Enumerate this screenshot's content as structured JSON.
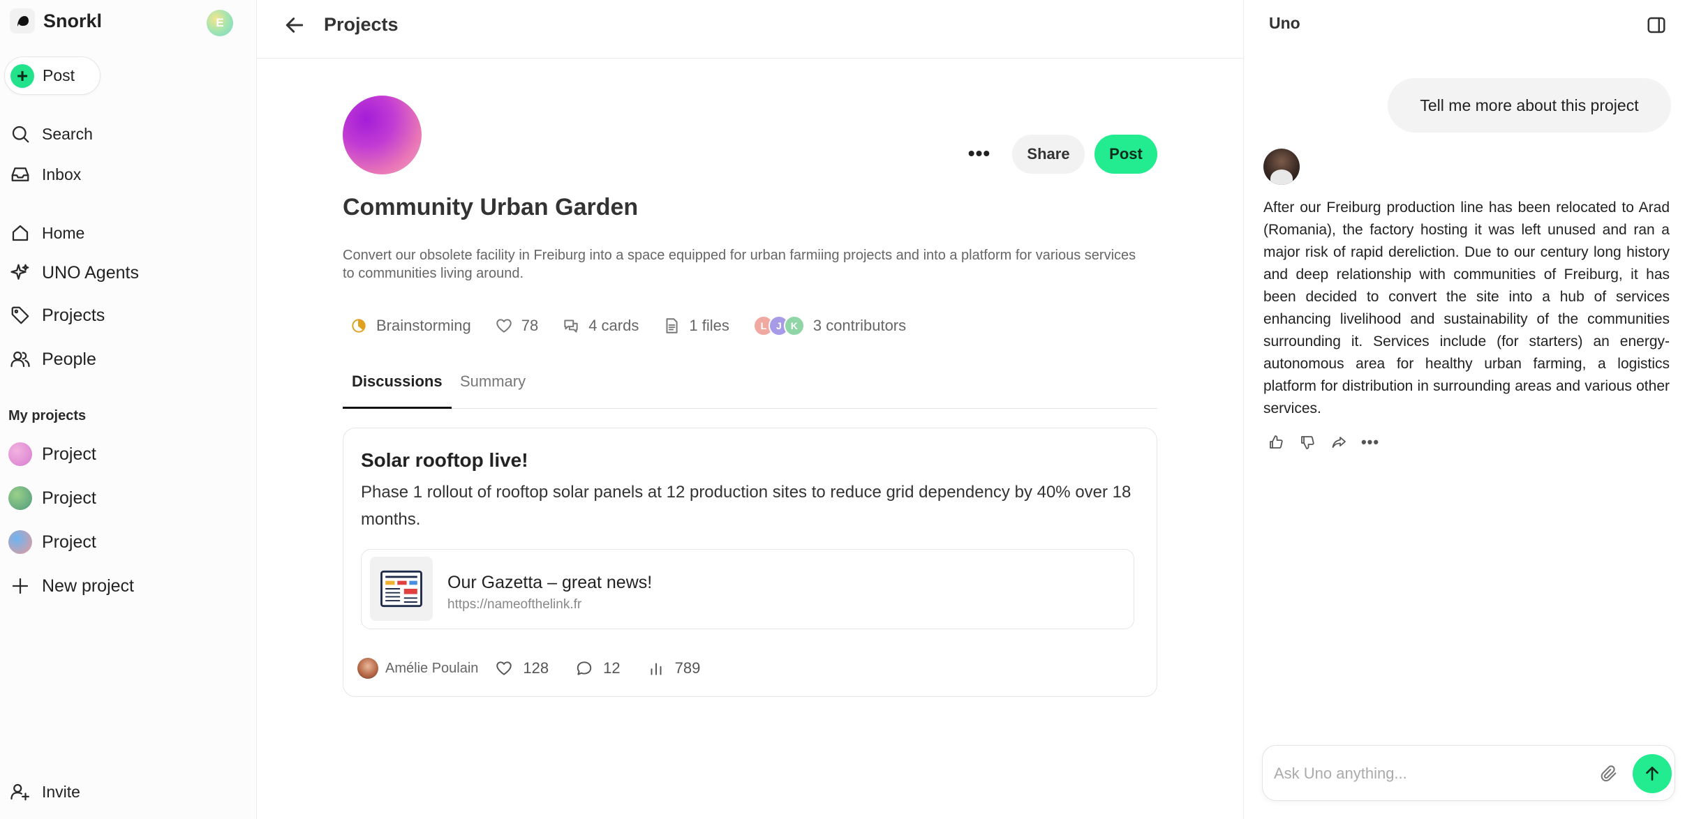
{
  "app": {
    "brand": "Snorkl",
    "user_initial": "E"
  },
  "sidebar": {
    "post_label": "Post",
    "nav": [
      {
        "label": "Search",
        "icon": "search-icon"
      },
      {
        "label": "Inbox",
        "icon": "inbox-icon"
      },
      {
        "label": "Home",
        "icon": "home-icon"
      },
      {
        "label": "UNO Agents",
        "icon": "sparkle-icon"
      },
      {
        "label": "Projects",
        "icon": "tag-icon"
      },
      {
        "label": "People",
        "icon": "people-icon"
      }
    ],
    "my_projects_title": "My projects",
    "projects": [
      {
        "label": "Project",
        "color": "#e58ad4"
      },
      {
        "label": "Project",
        "color": "#6fb07a"
      },
      {
        "label": "Project",
        "color": "#5aa8e8"
      }
    ],
    "new_project_label": "New project",
    "invite_label": "Invite"
  },
  "header": {
    "title": "Projects"
  },
  "project": {
    "name": "Community Urban Garden",
    "description": "Convert our obsolete facility in Freiburg into a space equipped for urban farmiing projects and into a platform for various services to communities living around.",
    "share_label": "Share",
    "post_label": "Post",
    "stats": {
      "stage": "Brainstorming",
      "likes": "78",
      "cards": "4 cards",
      "files": "1 files",
      "contributors": "3 contributors",
      "contributor_initials": [
        "L",
        "J",
        "K"
      ]
    },
    "tabs": [
      {
        "label": "Discussions",
        "active": true
      },
      {
        "label": "Summary",
        "active": false
      }
    ]
  },
  "post": {
    "title": "Solar rooftop live!",
    "body": "Phase 1 rollout of rooftop solar panels at 12 production sites to reduce grid dependency by 40% over 18 months.",
    "link": {
      "title": "Our Gazetta – great news!",
      "url": "https://nameofthelink.fr"
    },
    "author": "Amélie Poulain",
    "likes": "128",
    "comments": "12",
    "views": "789"
  },
  "uno": {
    "title": "Uno",
    "user_message": "Tell me more about this project",
    "bot_message": "After our Freiburg production line has been relocated to Arad (Romania), the factory hosting it was left unused and ran a major risk of rapid dereliction. Due to our century long history and deep relationship with communities of Freiburg, it has been decided to convert the site into a hub of services enhancing livelihood and sustainability of the communities surrounding it. Services include (for starters) an energy-autonomous area for healthy urban farming, a logistics platform for distribution in surrounding areas and various other services.",
    "input_placeholder": "Ask Uno anything..."
  },
  "colors": {
    "accent": "#22ec8f",
    "stage": "#e0a020"
  }
}
